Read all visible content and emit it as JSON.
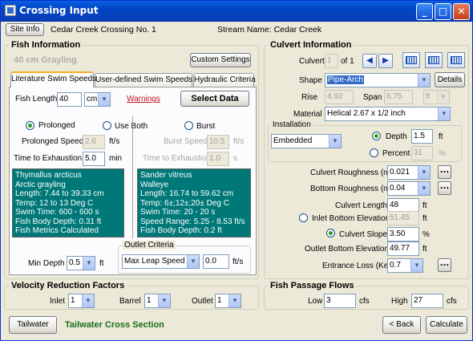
{
  "window": {
    "title": "Crossing Input"
  },
  "header": {
    "site_info_button": "Site Info",
    "crossing_name": "Cedar Creek Crossing No. 1",
    "stream_name": "Stream Name: Cedar Creek"
  },
  "fish": {
    "section_title": "Fish Information",
    "fish_name": "40 cm Grayling",
    "custom_settings_button": "Custom Settings",
    "tabs": [
      {
        "label": "Literature Swim Speeds"
      },
      {
        "label": "User-defined Swim Speeds"
      },
      {
        "label": "Hydraulic Criteria"
      }
    ],
    "fish_length_label": "Fish Length",
    "fish_length_value": "40",
    "fish_length_unit": "cm",
    "warnings_link": "Warnings",
    "select_data_button": "Select Data",
    "radio_prolonged": "Prolonged",
    "radio_use_both": "Use Both",
    "radio_burst": "Burst",
    "prolonged_speed_label": "Prolonged Speed",
    "prolonged_speed_value": "2.6",
    "prolonged_speed_unit": "ft/s",
    "time_exhaustion_label": "Time to Exhaustion",
    "time_exhaustion_value": "5.0",
    "time_exhaustion_unit": "min",
    "burst_speed_label": "Burst Speed",
    "burst_speed_value": "10.5",
    "burst_speed_unit": "ft/s",
    "burst_time_label": "Time to Exhaustion",
    "burst_time_value": "1.0",
    "burst_time_unit": "s",
    "left_info": [
      "Thymallus arcticus",
      "Arctic grayling",
      "Length: 7.44 to 39.33 cm",
      "Temp: 12 to 13 Deg C",
      "Swim Time: 600 - 600 s",
      "Fish Body Depth: 0.31 ft",
      "Fish Metrics Calculated"
    ],
    "right_info": [
      "Sander vitreus",
      "Walleye",
      "Length: 16.74 to 59.62 cm",
      "Temp: 6±;12±;20± Deg C",
      "Swim Time: 20 - 20 s",
      "Speed Range: 5.25 - 8.53 ft/s",
      "Fish Body Depth: 0.2 ft"
    ],
    "min_depth_label": "Min  Depth",
    "min_depth_value": "0.5",
    "min_depth_unit": "ft",
    "outlet_criteria_title": "Outlet Criteria",
    "outlet_criteria_select": "Max Leap Speed",
    "outlet_criteria_value": "0.0",
    "outlet_criteria_unit": "ft/s"
  },
  "culvert": {
    "section_title": "Culvert Information",
    "culvert_label": "Culvert",
    "culvert_value": "1",
    "culvert_of": "of 1",
    "shape_label": "Shape",
    "shape_value": "Pipe-Arch",
    "details_button": "Details",
    "rise_label": "Rise",
    "rise_value": "4.92",
    "span_label": "Span",
    "span_value": "6.75",
    "span_unit": "ft",
    "material_label": "Material",
    "material_value": "Helical 2.67 x 1/2 inch",
    "installation_title": "Installation",
    "installation_value": "Embedded",
    "depth_label": "Depth",
    "depth_value": "1.5",
    "depth_unit": "ft",
    "percent_label": "Percent",
    "percent_value": "31",
    "percent_unit": "%",
    "culvert_roughness_label": "Culvert Roughness (n)",
    "culvert_roughness_value": "0.021",
    "bottom_roughness_label": "Bottom Roughness (n)",
    "bottom_roughness_value": "0.04",
    "culvert_length_label": "Culvert Length",
    "culvert_length_value": "48",
    "culvert_length_unit": "ft",
    "inlet_bottom_label": "Inlet Bottom Elevation",
    "inlet_bottom_value": "51.45",
    "inlet_bottom_unit": "ft",
    "culvert_slope_label": "Culvert Slope",
    "culvert_slope_value": "3.50",
    "culvert_slope_unit": "%",
    "outlet_bottom_label": "Outlet Bottom Elevation",
    "outlet_bottom_value": "49.77",
    "outlet_bottom_unit": "ft",
    "entrance_loss_label": "Entrance Loss (Ke)",
    "entrance_loss_value": "0.7",
    "dots": "..."
  },
  "velocity": {
    "section_title": "Velocity Reduction Factors",
    "inlet_label": "Inlet",
    "inlet_value": "1",
    "barrel_label": "Barrel",
    "barrel_value": "1",
    "outlet_label": "Outlet",
    "outlet_value": "1"
  },
  "flows": {
    "section_title": "Fish Passage Flows",
    "low_label": "Low",
    "low_value": "3",
    "low_unit": "cfs",
    "high_label": "High",
    "high_value": "27",
    "high_unit": "cfs"
  },
  "footer": {
    "tailwater_button": "Tailwater",
    "tailwater_text": "Tailwater Cross Section",
    "back_button": "< Back",
    "calculate_button": "Calculate"
  },
  "colors": {
    "titlebar": "#0a5fe0",
    "info_panel": "#007878",
    "warning": "#c0111f",
    "tailwater_text": "#1a6e1a"
  }
}
